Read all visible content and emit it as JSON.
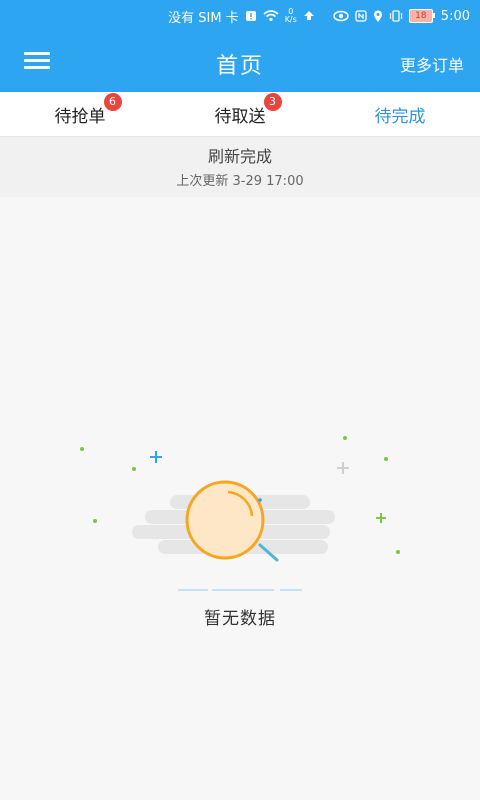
{
  "status_bar": {
    "carrier": "没有 SIM 卡",
    "speed_value": "0",
    "speed_unit": "K/s",
    "battery": "18",
    "time": "5:00",
    "icons": [
      "sim-warning-icon",
      "wifi-icon",
      "upload-icon",
      "eye-icon",
      "nfc-icon",
      "location-icon",
      "vibrate-icon",
      "battery-icon"
    ]
  },
  "appbar": {
    "title": "首页",
    "more_label": "更多订单"
  },
  "tabs": [
    {
      "label": "待抢单",
      "badge": "6",
      "active": false
    },
    {
      "label": "待取送",
      "badge": "3",
      "active": false
    },
    {
      "label": "待完成",
      "badge": "",
      "active": true
    }
  ],
  "refresh": {
    "title": "刷新完成",
    "last_update": "上次更新 3-29 17:00"
  },
  "empty_state": {
    "message": "暂无数据",
    "illustration": "magnifier-empty-icon"
  },
  "colors": {
    "primary": "#2da5f1",
    "tab_active": "#2b95d6",
    "badge": "#e8453c",
    "magnifier_ring": "#f5a623"
  }
}
